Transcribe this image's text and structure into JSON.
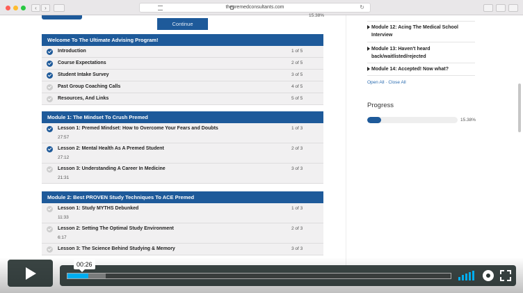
{
  "browser": {
    "url": "thepremedconsultants.com",
    "back_glyph": "‹",
    "forward_glyph": "›",
    "reload_glyph": "↻"
  },
  "top": {
    "continue_label": "Continue",
    "percent": "15.38%"
  },
  "sections": [
    {
      "title": "Welcome To The Ultimate Advising Program!",
      "items": [
        {
          "title": "Introduction",
          "duration": "",
          "fraction": "1 of 5",
          "complete": true
        },
        {
          "title": "Course Expectations",
          "duration": "",
          "fraction": "2 of 5",
          "complete": true
        },
        {
          "title": "Student Intake Survey",
          "duration": "",
          "fraction": "3 of 5",
          "complete": true
        },
        {
          "title": "Past Group Coaching Calls",
          "duration": "",
          "fraction": "4 of 5",
          "complete": false
        },
        {
          "title": "Resources, And Links",
          "duration": "",
          "fraction": "5 of 5",
          "complete": false
        }
      ]
    },
    {
      "title": "Module 1: The Mindset To Crush Premed",
      "items": [
        {
          "title": "Lesson 1: Premed Mindset: How to Overcome Your Fears and Doubts",
          "duration": "27:57",
          "fraction": "1 of 3",
          "complete": true
        },
        {
          "title": "Lesson 2: Mental Health As A Premed Student",
          "duration": "27:12",
          "fraction": "2 of 3",
          "complete": true
        },
        {
          "title": "Lesson 3: Understanding A Career In Medicine",
          "duration": "21:31",
          "fraction": "3 of 3",
          "complete": false
        }
      ]
    },
    {
      "title": "Module 2: Best PROVEN Study Techniques To ACE Premed",
      "items": [
        {
          "title": "Lesson 1: Study MYTHS Debunked",
          "duration": "11:33",
          "fraction": "1 of 3",
          "complete": false
        },
        {
          "title": "Lesson 2: Setting The Optimal Study Environment",
          "duration": "6:17",
          "fraction": "2 of 3",
          "complete": false
        },
        {
          "title": "Lesson 3: The Science Behind Studying & Memory",
          "duration": "",
          "fraction": "3 of 3",
          "complete": false
        }
      ]
    }
  ],
  "sidebar": {
    "modules": [
      "Module 12: Acing The Medical School Interview",
      "Module 13: Haven't heard back/waitlisted/rejected",
      "Module 14: Accepted! Now what?"
    ],
    "open_all": "Open All",
    "separator": "·",
    "close_all": "Close All",
    "progress_label": "Progress",
    "progress_percent": "15.38%",
    "progress_value": 15.38
  },
  "video": {
    "timecode": "00:26",
    "played_fraction": 0.055,
    "loaded_fraction": 0.1
  },
  "colors": {
    "brand": "#1e5a9a",
    "player_accent": "#00adef"
  }
}
